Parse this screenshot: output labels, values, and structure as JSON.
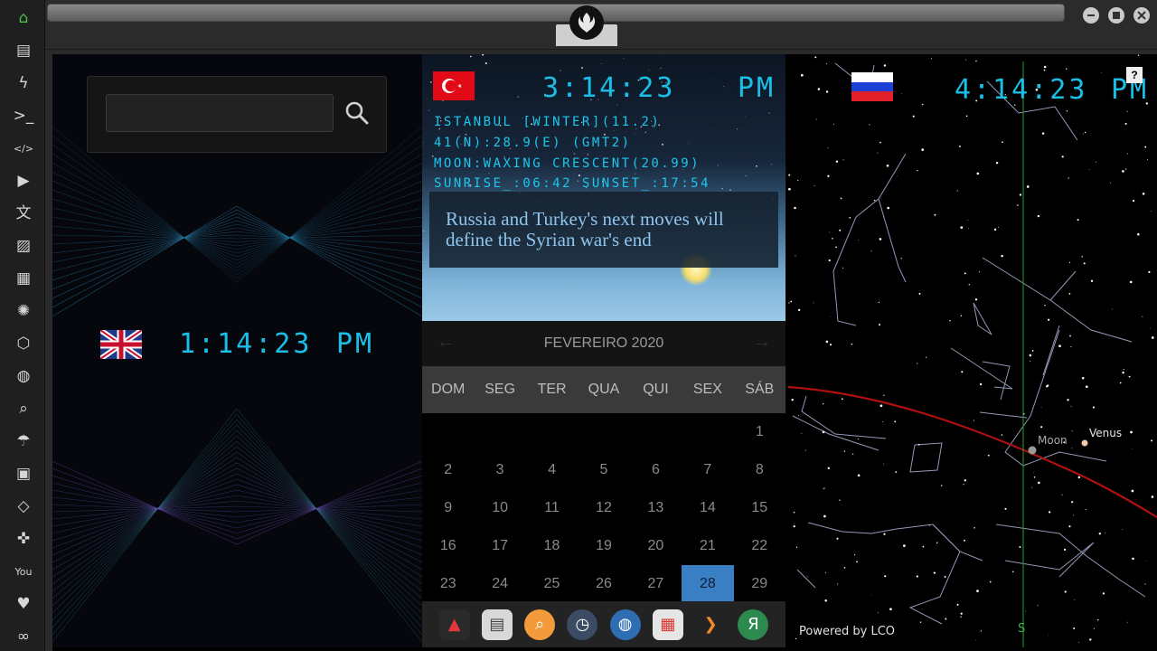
{
  "sidebar": {
    "items": [
      {
        "name": "home-icon",
        "glyph": "⌂"
      },
      {
        "name": "document-icon",
        "glyph": "▤"
      },
      {
        "name": "lightning-icon",
        "glyph": "ϟ"
      },
      {
        "name": "terminal-icon",
        "glyph": ">_"
      },
      {
        "name": "code-icon",
        "glyph": "</>"
      },
      {
        "name": "play-icon",
        "glyph": "▶"
      },
      {
        "name": "translate-icon",
        "glyph": "文"
      },
      {
        "name": "image-icon",
        "glyph": "▨"
      },
      {
        "name": "news-icon",
        "glyph": "▦"
      },
      {
        "name": "aperture-icon",
        "glyph": "✺"
      },
      {
        "name": "cube-icon",
        "glyph": "⬡"
      },
      {
        "name": "globe-icon",
        "glyph": "◍"
      },
      {
        "name": "search-icon",
        "glyph": "⌕"
      },
      {
        "name": "umbrella-icon",
        "glyph": "☂"
      },
      {
        "name": "contacts-icon",
        "glyph": "▣"
      },
      {
        "name": "link-icon",
        "glyph": "◇"
      },
      {
        "name": "expand-icon",
        "glyph": "✜"
      },
      {
        "name": "youtube-icon",
        "glyph": "You"
      },
      {
        "name": "heart-icon",
        "glyph": "♥"
      },
      {
        "name": "infinity-icon",
        "glyph": "∞"
      }
    ],
    "active_color": "#4fbf4f"
  },
  "search": {
    "placeholder": "",
    "value": ""
  },
  "clocks": {
    "uk": {
      "time": "1:14:23",
      "ampm": "PM"
    },
    "tr": {
      "time": "3:14:23",
      "ampm": "PM"
    },
    "ru": {
      "time": "4:14:23",
      "ampm": "PM"
    }
  },
  "turkey_info": {
    "line1": "ISTANBUL [WINTER](11.2)",
    "line2": "41(N):28.9(E) (GMT2)",
    "line3": "MOON:WAXING CRESCENT(20.99)",
    "line4": "SUNRISE_:06:42 SUNSET_:17:54"
  },
  "news": {
    "headline": "Russia and Turkey's next moves will define the Syrian war's end"
  },
  "calendar": {
    "month_label": "FEVEREIRO 2020",
    "prev": "←",
    "next": "→",
    "day_names": [
      "DOM",
      "SEG",
      "TER",
      "QUA",
      "QUI",
      "SEX",
      "SÁB"
    ],
    "leading_blanks": 6,
    "days": [
      1,
      2,
      3,
      4,
      5,
      6,
      7,
      8,
      9,
      10,
      11,
      12,
      13,
      14,
      15,
      16,
      17,
      18,
      19,
      20,
      21,
      22,
      23,
      24,
      25,
      26,
      27,
      28,
      29
    ],
    "today": 28
  },
  "dock": [
    {
      "name": "dock-app-red-icon",
      "glyph": "▲",
      "bg": "#2a2a2a",
      "fg": "#e0373c"
    },
    {
      "name": "dock-news-icon",
      "glyph": "▤",
      "bg": "#d8d8d8",
      "fg": "#444"
    },
    {
      "name": "dock-search-icon",
      "glyph": "⌕",
      "bg": "#f39a3b",
      "fg": "#fff"
    },
    {
      "name": "dock-clock-icon",
      "glyph": "◷",
      "bg": "#3b4b63",
      "fg": "#fff"
    },
    {
      "name": "dock-globe-icon",
      "glyph": "◍",
      "bg": "#2f6db3",
      "fg": "#fff"
    },
    {
      "name": "dock-calendar-icon",
      "glyph": "▦",
      "bg": "#e6e6e6",
      "fg": "#d33"
    },
    {
      "name": "dock-forward-icon",
      "glyph": "❯",
      "bg": "#232323",
      "fg": "#f28c28"
    },
    {
      "name": "dock-yandex-icon",
      "glyph": "Я",
      "bg": "#2d8a4e",
      "fg": "#fff"
    }
  ],
  "starmap": {
    "moon_label": "Moon",
    "venus_label": "Venus",
    "south_label": "S",
    "powered_by": "Powered by LCO",
    "help": "?"
  }
}
